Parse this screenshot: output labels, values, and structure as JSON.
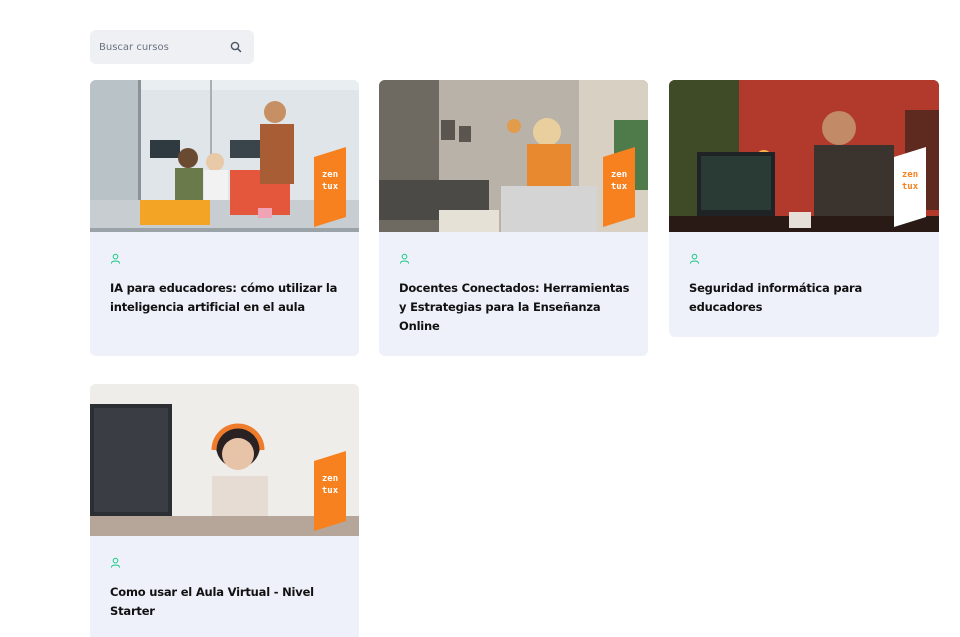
{
  "search": {
    "placeholder": "Buscar cursos",
    "icon": "search-icon"
  },
  "courses": [
    {
      "title": "IA para educadores: cómo utilizar la inteligencia artificial en el aula",
      "icon": "user-icon",
      "badge_text": "zen tux"
    },
    {
      "title": "Docentes Conectados: Herramientas y Estrategias para la Enseñanza Online",
      "icon": "user-icon",
      "badge_text": "zen tux"
    },
    {
      "title": "Seguridad informática para educadores",
      "icon": "user-icon",
      "badge_text": "zen tux"
    },
    {
      "title": "Como usar el Aula Virtual - Nivel Starter",
      "icon": "user-icon",
      "badge_text": "zen tux"
    }
  ],
  "colors": {
    "card_bg": "#eef1fa",
    "accent_green": "#2ecc8f",
    "badge_orange": "#f7811e",
    "search_bg": "#eef0f4"
  }
}
